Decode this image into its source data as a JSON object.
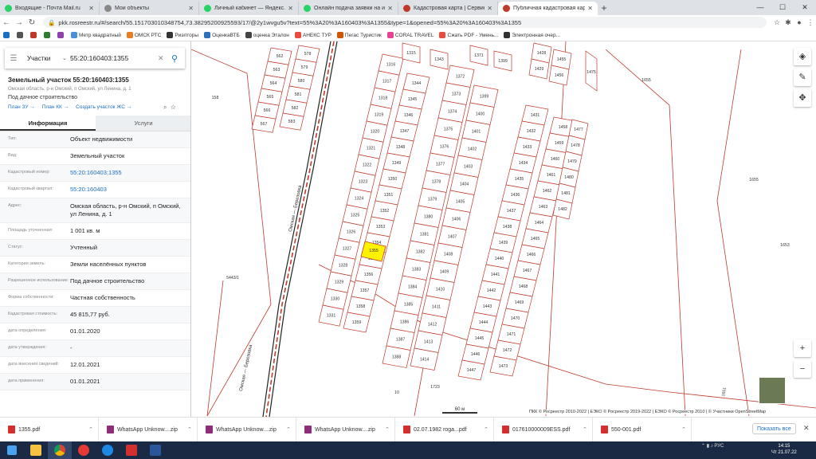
{
  "browser": {
    "tabs": [
      {
        "title": "Входящие - Почта Mail.ru",
        "color": "#25d366"
      },
      {
        "title": "Мои объекты",
        "color": "#888"
      },
      {
        "title": "Личный кабинет — Яндекс.Неду",
        "color": "#25d366"
      },
      {
        "title": "Онлайн подача заявки на ипот",
        "color": "#25d366"
      },
      {
        "title": "Кадастровая карта | Сервис Ка",
        "color": "#c0392b"
      },
      {
        "title": "Публичная кадастровая карта",
        "color": "#c0392b",
        "active": true
      }
    ],
    "new_tab": "+",
    "url": "pkk.rosreestr.ru/#/search/55.151703010348754,73.38295200925593/17/@2y1wvgu5v?text=55%3A20%3A160403%3A1355&type=1&opened=55%3A20%3A160403%3A1355",
    "bookmarks": [
      {
        "label": "",
        "color": "#1a6fc4"
      },
      {
        "label": "",
        "color": "#555"
      },
      {
        "label": "",
        "color": "#c0392b"
      },
      {
        "label": "",
        "color": "#2e7d32"
      },
      {
        "label": "",
        "color": "#8e44ad"
      },
      {
        "label": "Метр квадратный",
        "color": "#4a90d9"
      },
      {
        "label": "ОМСК РТС",
        "color": "#e67e22"
      },
      {
        "label": "Риэлторы",
        "color": "#333"
      },
      {
        "label": "ОценкаВТБ",
        "color": "#2d72b8"
      },
      {
        "label": "оценка Эталон",
        "color": "#444"
      },
      {
        "label": "АНЕКС ТУР",
        "color": "#e74c3c"
      },
      {
        "label": "Пегас Туристик",
        "color": "#d35400"
      },
      {
        "label": "CORAL TRAVEL",
        "color": "#e84393"
      },
      {
        "label": "Сжать PDF - Умень...",
        "color": "#e74c3c"
      },
      {
        "label": "Электронная очер...",
        "color": "#333"
      }
    ]
  },
  "search": {
    "type_label": "Участки",
    "value": "55:20:160403:1355"
  },
  "object": {
    "title": "Земельный участок 55:20:160403:1355",
    "address_short": "Омская область, р-н Омский, п Омский, ул Ленина, д. 1",
    "use": "Под дачное строительство",
    "links": [
      "План ЗУ →",
      "План КК →",
      "Создать участок ЖС →"
    ]
  },
  "tabs": {
    "info": "Информация",
    "services": "Услуги"
  },
  "properties": [
    {
      "label": "Тип:",
      "value": "Объект недвижимости"
    },
    {
      "label": "Вид:",
      "value": "Земельный участок"
    },
    {
      "label": "Кадастровый номер:",
      "value": "55:20:160403:1355",
      "link": true
    },
    {
      "label": "Кадастровый квартал:",
      "value": "55:20:160403",
      "link": true
    },
    {
      "label": "Адрес:",
      "value": "Омская область, р-н Омский, п Омский, ул Ленина, д. 1"
    },
    {
      "label": "Площадь уточненная:",
      "value": "1 001 кв. м"
    },
    {
      "label": "Статус:",
      "value": "Учтенный"
    },
    {
      "label": "Категория земель:",
      "value": "Земли населённых пунктов"
    },
    {
      "label": "Разрешенное использование:",
      "value": "Под дачное строительство"
    },
    {
      "label": "Форма собственности:",
      "value": "Частная собственность"
    },
    {
      "label": "Кадастровая стоимость:",
      "value": "45 815,77 руб."
    },
    {
      "label": "дата определения:",
      "value": "01.01.2020"
    },
    {
      "label": "дата утверждения:",
      "value": "-"
    },
    {
      "label": "дата внесения сведений:",
      "value": "12.01.2021"
    },
    {
      "label": "дата применения:",
      "value": "01.01.2021"
    }
  ],
  "map": {
    "scale": "60 м",
    "copyright": "ПКК © Росреестр 2010-2022 | ЕЭКО © Росреестр 2019-2022 | ЕЭКО © Росреестр 2010 | © Участники OpenStreetMap",
    "road_label": "Омская — Березовка",
    "selected": "1355",
    "parcel_color": "#c0392b",
    "selected_color": "#fff200"
  },
  "downloads": {
    "items": [
      "1355.pdf",
      "WhatsApp Unknow....zip",
      "WhatsApp Unknow....zip",
      "WhatsApp Unknow....zip",
      "02.07.1982 roga...pdf",
      "017610000009ESS.pdf",
      "550-001.pdf"
    ],
    "show_all": "Показать все"
  },
  "taskbar": {
    "lang": "РУС",
    "time": "14:15",
    "date": "Чт 21.07.22"
  }
}
